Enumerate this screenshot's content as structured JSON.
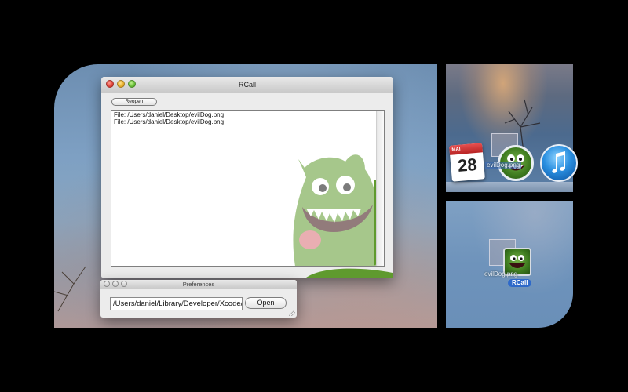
{
  "rcall_window": {
    "title": "RCall",
    "reopen_label": "Reopen",
    "log_lines": [
      "File: /Users/daniel/Desktop/evilDog.png",
      "File: /Users/daniel/Desktop/evilDog.png"
    ]
  },
  "preferences_window": {
    "title": "Preferences",
    "path_value": "/Users/daniel/Library/Developer/Xcode/",
    "open_label": "Open"
  },
  "dock": {
    "calendar_month": "MAI",
    "calendar_day": "28",
    "dragged_file_label": "evilDog.png",
    "app_label": "RCall"
  },
  "colors": {
    "rcall_badge": "#2e69c9",
    "monster_green": "#5f9a2e"
  },
  "icons": [
    "monster-illustration",
    "calendar-icon",
    "itunes-icon",
    "rcall-app-icon",
    "file-ghost-icon"
  ]
}
